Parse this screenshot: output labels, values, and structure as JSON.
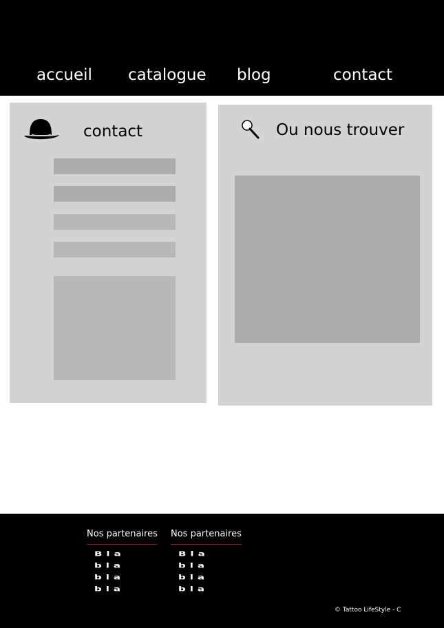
{
  "nav": {
    "items": [
      {
        "label": "accueil"
      },
      {
        "label": "catalogue"
      },
      {
        "label": "blog"
      },
      {
        "label": "contact"
      }
    ]
  },
  "contact_panel": {
    "title": "contact",
    "icon": "bowler-hat-icon"
  },
  "location_panel": {
    "title": "Ou nous trouver",
    "icon": "magnifier-icon"
  },
  "footer": {
    "columns": [
      {
        "title": "Nos partenaires",
        "lines": [
          "Bla",
          "bla",
          "bla",
          "bla"
        ]
      },
      {
        "title": "Nos partenaires",
        "lines": [
          "Bla",
          "bla",
          "bla",
          "bla"
        ]
      }
    ],
    "copyright": "© Tattoo LifeStyle - C"
  },
  "colors": {
    "header_bg": "#000000",
    "panel_bg": "#d3d3d3",
    "placeholder_dark": "#acacac",
    "placeholder_light": "#b8b8b8",
    "accent_rule": "#8b1a1a"
  }
}
